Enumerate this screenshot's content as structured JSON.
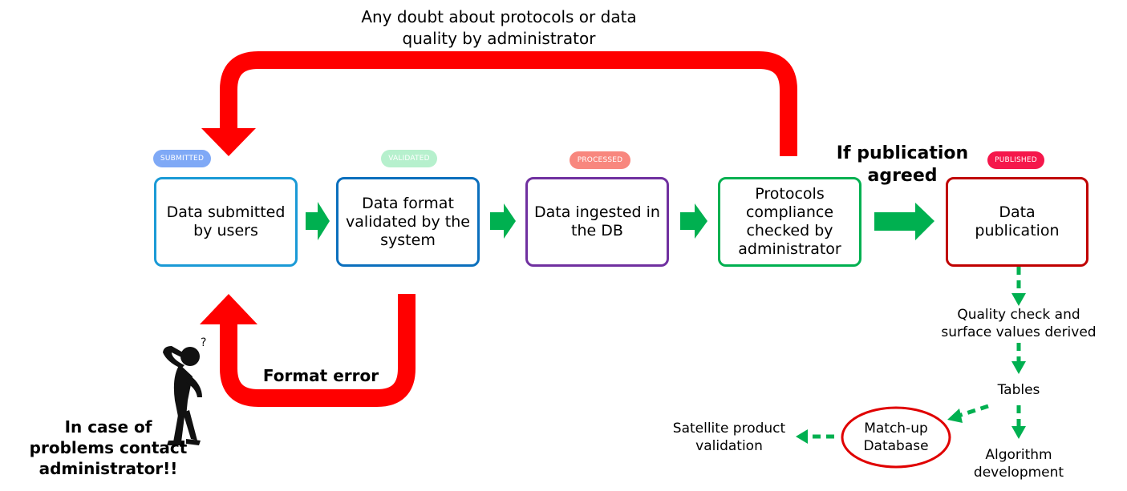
{
  "feedback_loop": {
    "label": "Any doubt about protocols or data\nquality by administrator",
    "color": "#ff0000"
  },
  "format_error": {
    "label": "Format error"
  },
  "publication_condition": {
    "label": "If publication\nagreed"
  },
  "help_note": {
    "label": "In case of\nproblems contact\nadministrator!!"
  },
  "stages": [
    {
      "badge": "SUBMITTED",
      "badge_color": "#7fa9f6",
      "label": "Data submitted by users",
      "border_color": "#1a9ad6"
    },
    {
      "badge": "VALIDATED",
      "badge_color": "#b6f0cd",
      "label": "Data format validated by the system",
      "border_color": "#0b6fbd"
    },
    {
      "badge": "PROCESSED",
      "badge_color": "#f8877e",
      "label": "Data ingested in the DB",
      "border_color": "#7030a0"
    },
    {
      "badge": "",
      "badge_color": "",
      "label": "Protocols compliance checked by administrator",
      "border_color": "#00b050"
    },
    {
      "badge": "PUBLISHED",
      "badge_color": "#f5174b",
      "label": "Data publication",
      "border_color": "#c00000"
    }
  ],
  "downstream": {
    "quality": "Quality check and\nsurface values derived",
    "tables": "Tables",
    "algorithm": "Algorithm\ndevelopment",
    "matchup": "Match-up\nDatabase",
    "satellite": "Satellite product\nvalidation"
  },
  "colors": {
    "flow_arrow": "#00b050",
    "loop_arrow": "#ff0000"
  }
}
